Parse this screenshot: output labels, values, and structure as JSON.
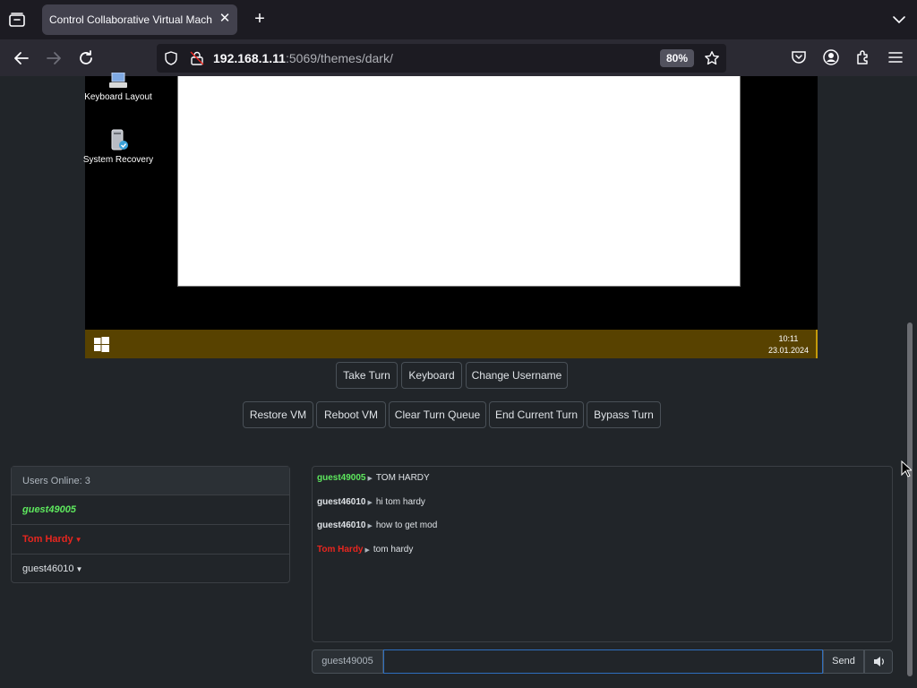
{
  "browser": {
    "tab_title": "Control Collaborative Virtual Machine",
    "url_host": "192.168.1.11",
    "url_rest": ":5069/themes/dark/",
    "zoom": "80%"
  },
  "vm": {
    "desktop_icons": [
      {
        "label": "Keyboard Layout",
        "icon": "keyboard-layout-icon"
      },
      {
        "label": "System Recovery",
        "icon": "system-recovery-icon"
      }
    ],
    "clock_time": "10:11",
    "clock_date": "23.01.2024"
  },
  "controls": {
    "take_turn": "Take Turn",
    "keyboard": "Keyboard",
    "change_username": "Change Username",
    "restore_vm": "Restore VM",
    "reboot_vm": "Reboot VM",
    "clear_turn_queue": "Clear Turn Queue",
    "end_current_turn": "End Current Turn",
    "bypass_turn": "Bypass Turn"
  },
  "users": {
    "header": "Users Online: 3",
    "list": [
      {
        "name": "guest49005",
        "color": "#5ee85e",
        "italic": true,
        "caret": false
      },
      {
        "name": "Tom Hardy",
        "color": "#e8261f",
        "italic": false,
        "caret": true
      },
      {
        "name": "guest46010",
        "color": "#dee2e6",
        "italic": false,
        "caret": true
      }
    ]
  },
  "chat": {
    "messages": [
      {
        "user": "guest49005",
        "color": "#5ee85e",
        "text": "TOM HARDY"
      },
      {
        "user": "guest46010",
        "color": "#dee2e6",
        "text": "hi tom hardy"
      },
      {
        "user": "guest46010",
        "color": "#dee2e6",
        "text": "how to get mod"
      },
      {
        "user": "Tom Hardy",
        "color": "#e8261f",
        "text": "tom hardy"
      }
    ],
    "username": "guest49005",
    "input_value": "",
    "send_label": "Send"
  },
  "colors": {
    "accent_input_border": "#2f6fbf",
    "taskbar": "#584200"
  }
}
